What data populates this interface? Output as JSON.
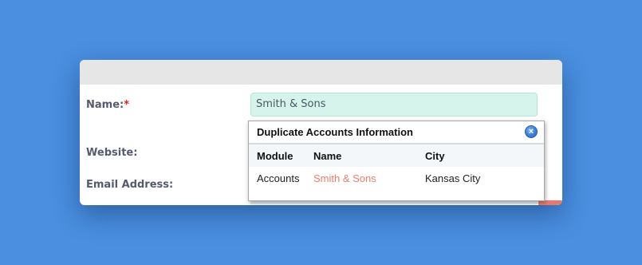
{
  "form": {
    "name_label": "Name:",
    "required_mark": "*",
    "name_value": "Smith & Sons",
    "website_label": "Website:",
    "email_label": "Email Address:"
  },
  "duplicate_popup": {
    "title": "Duplicate Accounts Information",
    "close_symbol": "×",
    "columns": [
      "Module",
      "Name",
      "City"
    ],
    "rows": [
      {
        "module": "Accounts",
        "name": "Smith & Sons",
        "city": "Kansas City"
      }
    ]
  },
  "colors": {
    "background": "#4a8fe0",
    "input_highlight": "#d6f4ec",
    "link": "#e9806f",
    "required": "#d0261f"
  }
}
